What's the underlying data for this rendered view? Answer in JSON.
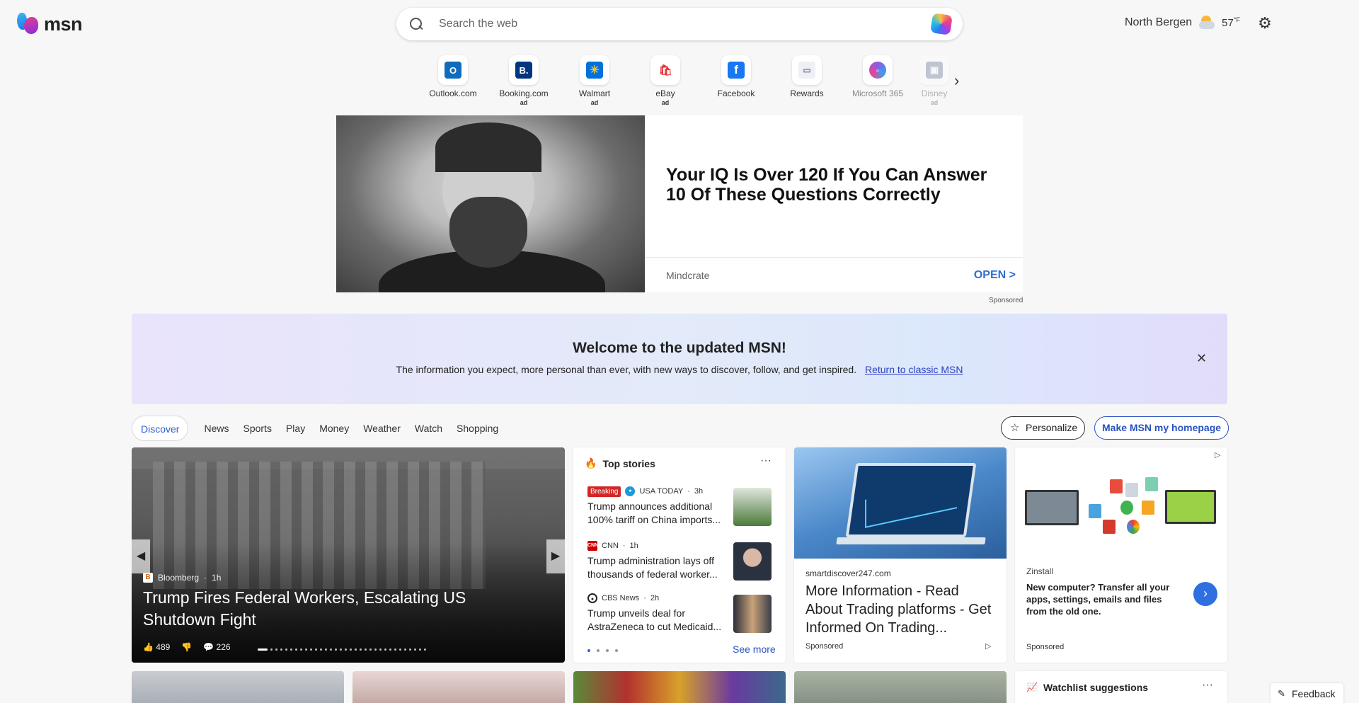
{
  "header": {
    "logo_text": "msn",
    "search_placeholder": "Search the web",
    "location": "North Bergen",
    "temperature": "57",
    "temperature_unit": "°F"
  },
  "quicklinks": [
    {
      "label": "Outlook.com",
      "ad": "",
      "icon": "outlook-icon",
      "color": "#0f6cbd"
    },
    {
      "label": "Booking.com",
      "ad": "ad",
      "icon": "booking-icon",
      "color": "#003580"
    },
    {
      "label": "Walmart",
      "ad": "ad",
      "icon": "walmart-icon",
      "color": "#0071dc"
    },
    {
      "label": "eBay",
      "ad": "ad",
      "icon": "ebay-icon",
      "color": "#e53238"
    },
    {
      "label": "Facebook",
      "ad": "",
      "icon": "facebook-icon",
      "color": "#1877f2"
    },
    {
      "label": "Rewards",
      "ad": "",
      "icon": "rewards-icon",
      "color": "#6b7a99"
    },
    {
      "label": "Microsoft 365",
      "ad": "",
      "icon": "microsoft365-icon",
      "color": "#8a5be8"
    },
    {
      "label": "Disney",
      "ad": "ad",
      "icon": "disney-icon",
      "color": "#5a6b8a"
    }
  ],
  "ad_banner": {
    "headline": "Your IQ Is Over 120 If You Can Answer 10 Of These Questions Correctly",
    "source": "Mindcrate",
    "cta": "OPEN >",
    "sponsored": "Sponsored"
  },
  "welcome": {
    "title": "Welcome to the updated MSN!",
    "text": "The information you expect, more personal than ever, with new ways to discover, follow, and get inspired.",
    "link": "Return to classic MSN"
  },
  "nav": {
    "tabs": [
      "Discover",
      "News",
      "Sports",
      "Play",
      "Money",
      "Weather",
      "Watch",
      "Shopping"
    ],
    "personalize": "Personalize",
    "make_home": "Make MSN my homepage"
  },
  "hero": {
    "source": "Bloomberg",
    "age": "1h",
    "title": "Trump Fires Federal Workers, Escalating US Shutdown Fight",
    "likes": "489",
    "comments": "226"
  },
  "top_stories": {
    "title": "Top stories",
    "breaking_label": "Breaking",
    "items": [
      {
        "source": "USA TODAY",
        "age": "3h",
        "title": "Trump announces additional 100% tariff on China imports..."
      },
      {
        "source": "CNN",
        "age": "1h",
        "title": "Trump administration lays off thousands of federal worker..."
      },
      {
        "source": "CBS News",
        "age": "2h",
        "title": "Trump unveils deal for AstraZeneca to cut Medicaid..."
      }
    ],
    "see_more": "See more"
  },
  "trading_ad": {
    "domain": "smartdiscover247.com",
    "title": "More Information - Read About Trading platforms - Get Informed On Trading...",
    "sponsored": "Sponsored"
  },
  "zinstall_ad": {
    "source": "Zinstall",
    "text": "New computer? Transfer all your apps, settings, emails and files from the old one.",
    "sponsored": "Sponsored"
  },
  "watchlist": {
    "title": "Watchlist suggestions"
  },
  "feedback": "Feedback"
}
